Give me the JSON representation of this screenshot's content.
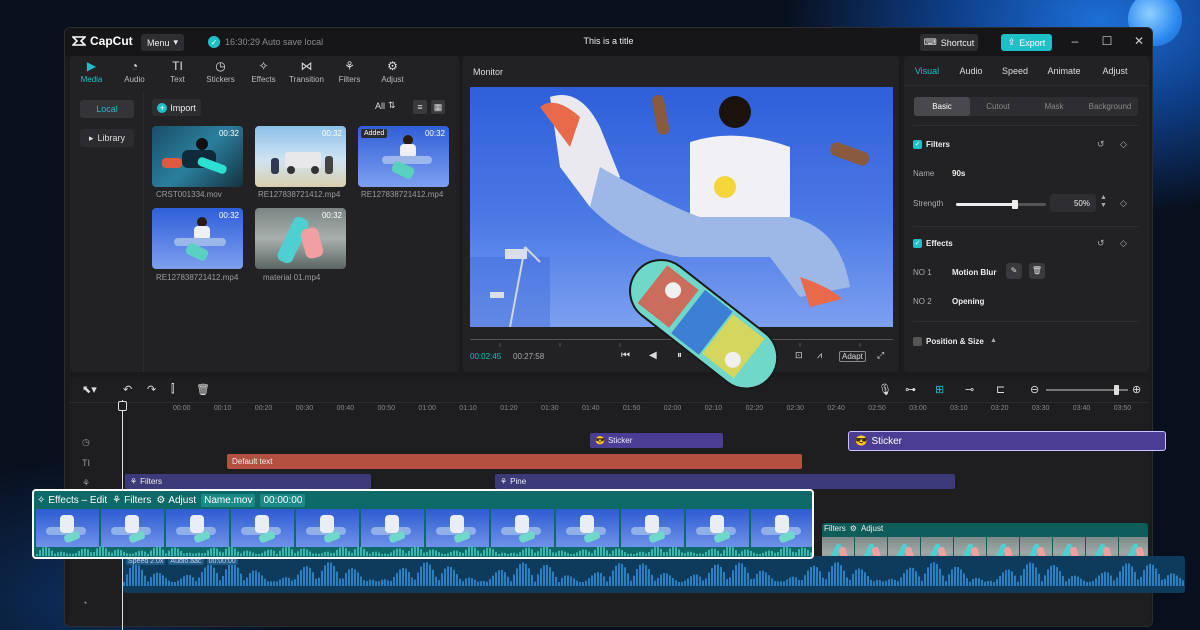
{
  "app": {
    "logo_text": "CapCut",
    "menu_label": "Menu",
    "autosave_text": "16:30:29 Auto save local",
    "window_title": "This is a title",
    "shortcut_label": "Shortcut",
    "export_label": "Export"
  },
  "media_tabs": [
    {
      "label": "Media",
      "icon": "media-icon"
    },
    {
      "label": "Audio",
      "icon": "audio-icon"
    },
    {
      "label": "Text",
      "icon": "text-icon"
    },
    {
      "label": "Stickers",
      "icon": "stickers-icon"
    },
    {
      "label": "Effects",
      "icon": "effects-icon"
    },
    {
      "label": "Transition",
      "icon": "transition-icon"
    },
    {
      "label": "Filters",
      "icon": "filters-icon"
    },
    {
      "label": "Adjust",
      "icon": "adjust-icon"
    }
  ],
  "media_side": {
    "local": "Local",
    "library": "Library"
  },
  "media_toolbar": {
    "import": "Import",
    "filter": "All"
  },
  "media_items": [
    {
      "name": "CRST001334.mov",
      "duration": "00:32",
      "added": ""
    },
    {
      "name": "RE127838721412.mp4",
      "duration": "00:32",
      "added": ""
    },
    {
      "name": "RE127838721412.mp4",
      "duration": "00:32",
      "added": "Added"
    },
    {
      "name": "RE127838721412.mp4",
      "duration": "00:32",
      "added": ""
    },
    {
      "name": "material 01.mp4",
      "duration": "00:32",
      "added": ""
    }
  ],
  "monitor": {
    "title": "Monitor",
    "current_time": "00:02:45",
    "total_time": "00:27:58",
    "adapt_label": "Adapt"
  },
  "inspector": {
    "tabs": [
      "Visual",
      "Audio",
      "Speed",
      "Animate",
      "Adjust"
    ],
    "subtabs": [
      "Basic",
      "Cutout",
      "Mask",
      "Background"
    ],
    "filters_label": "Filters",
    "name_label": "Name",
    "name_value": "90s",
    "strength_label": "Strength",
    "strength_value": "50%",
    "strength_fraction": 0.65,
    "effects_label": "Effects",
    "effects": [
      {
        "index": "NO 1",
        "name": "Motion Blur"
      },
      {
        "index": "NO 2",
        "name": "Opening"
      }
    ],
    "position_label": "Position & Size"
  },
  "timeline": {
    "ruler": [
      "00:00",
      "00:10",
      "00:20",
      "00:30",
      "00:40",
      "00:50",
      "01:00",
      "01:10",
      "01:20",
      "01:30",
      "01:40",
      "01:50",
      "02:00",
      "02:10",
      "02:20",
      "02:30",
      "02:40",
      "02:50",
      "03:00",
      "03:10",
      "03:20",
      "03:30",
      "03:40",
      "03:50"
    ],
    "zoom_fraction": 0.85,
    "sticker_clip": "Sticker",
    "sticker_pop": "Sticker",
    "text_clip": "Default text",
    "filters_clip": "Filters",
    "pine_clip": "Pine",
    "bg_filters_label": "Filters",
    "bg_adjust_label": "Adjust",
    "audio_speed": "Speed 2.0x",
    "audio_name": "Audio.aac",
    "audio_time": "00:00:00"
  },
  "pop_clip": {
    "effects": "Effects – Edit",
    "filters": "Filters",
    "adjust": "Adjust",
    "name": "Name.mov",
    "time": "00:00:00"
  },
  "colors": {
    "accent": "#1fbfc8",
    "sticker": "#4a3d93",
    "text_clip": "#b3503f",
    "filter_clip": "#3d3a7a",
    "video_clip": "#0f5d5a",
    "audio_clip": "#0e3a5c"
  }
}
